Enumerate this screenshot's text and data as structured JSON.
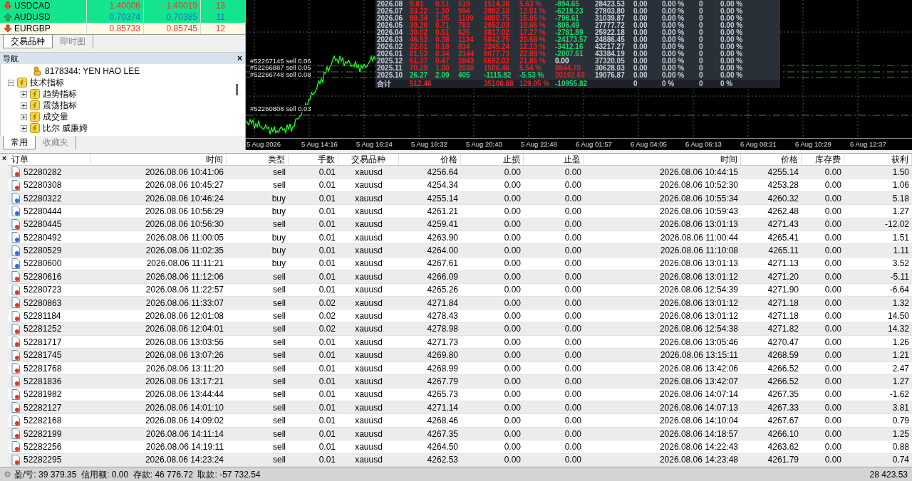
{
  "market_watch": {
    "rows": [
      {
        "symbol": "USDCAD",
        "bid": "1.40006",
        "ask": "1.40019",
        "spread": "13",
        "kind": "down",
        "highlighted": true
      },
      {
        "symbol": "AUDUSD",
        "bid": "0.70374",
        "ask": "0.70385",
        "spread": "11",
        "kind": "up",
        "highlighted": true
      },
      {
        "symbol": "EURGBP",
        "bid": "0.85733",
        "ask": "0.85745",
        "spread": "12",
        "kind": "down",
        "highlighted": false
      }
    ],
    "tabs": [
      {
        "label": "交易品种",
        "selected": true
      },
      {
        "label": "即时图",
        "selected": false
      }
    ]
  },
  "navigator": {
    "title": "导航",
    "close": "×",
    "tree": [
      {
        "label": "8178344: YEN HAO LEE",
        "kind": "account"
      },
      {
        "label": "技术指标",
        "kind": "folder",
        "expanded": true,
        "children": [
          {
            "label": "趋势指标",
            "kind": "folder",
            "expanded": false
          },
          {
            "label": "震荡指标",
            "kind": "folder",
            "expanded": false
          },
          {
            "label": "成交量",
            "kind": "folder",
            "expanded": false
          },
          {
            "label": "比尔 威廉姆",
            "kind": "folder",
            "expanded": false
          }
        ]
      }
    ],
    "tabs": [
      {
        "label": "常用",
        "selected": true
      },
      {
        "label": "收藏夹",
        "selected": false
      }
    ]
  },
  "chart": {
    "order_labels": [
      "#52267145 sell 0.06",
      "#52266887 sell 0.05",
      "#52266748 sell 0.08",
      "#52260808 sell 0.03"
    ],
    "stats": {
      "rows": [
        {
          "cells": [
            {
              "text": "2026.08",
              "color": "#c8d0dc"
            },
            {
              "text": "9.81",
              "color": "#e02424"
            },
            {
              "text": "0.51",
              "color": "#e02424"
            },
            {
              "text": "510",
              "color": "#e02424"
            },
            {
              "text": "1514.38",
              "color": "#e02424"
            },
            {
              "text": "5.63 %",
              "color": "#e02424"
            },
            {
              "text": "-894.65",
              "color": "#22d36a"
            },
            {
              "text": "28423.53",
              "color": "#c8d0dc"
            },
            {
              "text": "0.00",
              "color": "#c8d0dc"
            },
            {
              "text": "0.00 %",
              "color": "#c8d0dc"
            },
            {
              "text": "0",
              "color": "#c8d0dc"
            },
            {
              "text": "0.00 %",
              "color": "#c8d0dc"
            }
          ]
        },
        {
          "cells": [
            {
              "text": "2026.07",
              "color": "#c8d0dc"
            },
            {
              "text": "33.22",
              "color": "#e02424"
            },
            {
              "text": "1.30",
              "color": "#e02424"
            },
            {
              "text": "994",
              "color": "#e02424"
            },
            {
              "text": "2982.10",
              "color": "#e02424"
            },
            {
              "text": "12.01 %",
              "color": "#e02424"
            },
            {
              "text": "-6218.23",
              "color": "#22d36a"
            },
            {
              "text": "27803.80",
              "color": "#c8d0dc"
            },
            {
              "text": "0.00",
              "color": "#c8d0dc"
            },
            {
              "text": "0.00 %",
              "color": "#c8d0dc"
            },
            {
              "text": "0",
              "color": "#c8d0dc"
            },
            {
              "text": "0.00 %",
              "color": "#c8d0dc"
            }
          ]
        },
        {
          "cells": [
            {
              "text": "2026.06",
              "color": "#c8d0dc"
            },
            {
              "text": "80.34",
              "color": "#e02424"
            },
            {
              "text": "1.05",
              "color": "#e02424"
            },
            {
              "text": "1109",
              "color": "#e02424"
            },
            {
              "text": "4080.75",
              "color": "#e02424"
            },
            {
              "text": "15.05 %",
              "color": "#e02424"
            },
            {
              "text": "-798.61",
              "color": "#22d36a"
            },
            {
              "text": "31039.87",
              "color": "#c8d0dc"
            },
            {
              "text": "0.00",
              "color": "#c8d0dc"
            },
            {
              "text": "0.00 %",
              "color": "#c8d0dc"
            },
            {
              "text": "0",
              "color": "#c8d0dc"
            },
            {
              "text": "0.00 %",
              "color": "#c8d0dc"
            }
          ]
        },
        {
          "cells": [
            {
              "text": "2026.05",
              "color": "#c8d0dc"
            },
            {
              "text": "39.20",
              "color": "#e02424"
            },
            {
              "text": "0.71",
              "color": "#e02424"
            },
            {
              "text": "783",
              "color": "#e02424"
            },
            {
              "text": "2052.03",
              "color": "#e02424"
            },
            {
              "text": "10.66 %",
              "color": "#e02424"
            },
            {
              "text": "-806.49",
              "color": "#22d36a"
            },
            {
              "text": "27777.72",
              "color": "#c8d0dc"
            },
            {
              "text": "0.00",
              "color": "#c8d0dc"
            },
            {
              "text": "0.00 %",
              "color": "#c8d0dc"
            },
            {
              "text": "0",
              "color": "#c8d0dc"
            },
            {
              "text": "0.00 %",
              "color": "#c8d0dc"
            }
          ]
        },
        {
          "cells": [
            {
              "text": "2026.04",
              "color": "#c8d0dc"
            },
            {
              "text": "30.02",
              "color": "#e02424"
            },
            {
              "text": "0.51",
              "color": "#e02424"
            },
            {
              "text": "625",
              "color": "#e02424"
            },
            {
              "text": "3817.02",
              "color": "#e02424"
            },
            {
              "text": "17.27 %",
              "color": "#e02424"
            },
            {
              "text": "-2781.89",
              "color": "#22d36a"
            },
            {
              "text": "25922.18",
              "color": "#c8d0dc"
            },
            {
              "text": "0.00",
              "color": "#c8d0dc"
            },
            {
              "text": "0.00 %",
              "color": "#c8d0dc"
            },
            {
              "text": "0",
              "color": "#c8d0dc"
            },
            {
              "text": "0.00 %",
              "color": "#c8d0dc"
            }
          ]
        },
        {
          "cells": [
            {
              "text": "2026.03",
              "color": "#c8d0dc"
            },
            {
              "text": "46.53",
              "color": "#e02424"
            },
            {
              "text": "0.38",
              "color": "#e02424"
            },
            {
              "text": "1134",
              "color": "#e02424"
            },
            {
              "text": "5842.75",
              "color": "#e02424"
            },
            {
              "text": "20.68 %",
              "color": "#e02424"
            },
            {
              "text": "-24173.57",
              "color": "#22d36a"
            },
            {
              "text": "24886.45",
              "color": "#c8d0dc"
            },
            {
              "text": "0.00",
              "color": "#c8d0dc"
            },
            {
              "text": "0.00 %",
              "color": "#c8d0dc"
            },
            {
              "text": "0",
              "color": "#c8d0dc"
            },
            {
              "text": "0.00 %",
              "color": "#c8d0dc"
            }
          ]
        },
        {
          "cells": [
            {
              "text": "2026.02",
              "color": "#c8d0dc"
            },
            {
              "text": "22.01",
              "color": "#e02424"
            },
            {
              "text": "0.18",
              "color": "#e02424"
            },
            {
              "text": "834",
              "color": "#e02424"
            },
            {
              "text": "3245.24",
              "color": "#e02424"
            },
            {
              "text": "12.13 %",
              "color": "#e02424"
            },
            {
              "text": "-3412.16",
              "color": "#22d36a"
            },
            {
              "text": "43217.27",
              "color": "#c8d0dc"
            },
            {
              "text": "0.00",
              "color": "#c8d0dc"
            },
            {
              "text": "0.00 %",
              "color": "#c8d0dc"
            },
            {
              "text": "0",
              "color": "#c8d0dc"
            },
            {
              "text": "0.00 %",
              "color": "#c8d0dc"
            }
          ]
        },
        {
          "cells": [
            {
              "text": "2026.01",
              "color": "#c8d0dc"
            },
            {
              "text": "81.53",
              "color": "#e02424"
            },
            {
              "text": "0.34",
              "color": "#e02424"
            },
            {
              "text": "2144",
              "color": "#e02424"
            },
            {
              "text": "8077.73",
              "color": "#e02424"
            },
            {
              "text": "22.88 %",
              "color": "#e02424"
            },
            {
              "text": "-2007.61",
              "color": "#22d36a"
            },
            {
              "text": "43384.19",
              "color": "#c8d0dc"
            },
            {
              "text": "0.00",
              "color": "#c8d0dc"
            },
            {
              "text": "0.00 %",
              "color": "#c8d0dc"
            },
            {
              "text": "0",
              "color": "#c8d0dc"
            },
            {
              "text": "0.00 %",
              "color": "#c8d0dc"
            }
          ]
        },
        {
          "cells": [
            {
              "text": "2025.12",
              "color": "#c8d0dc"
            },
            {
              "text": "61.37",
              "color": "#e02424"
            },
            {
              "text": "0.47",
              "color": "#e02424"
            },
            {
              "text": "2843",
              "color": "#e02424"
            },
            {
              "text": "6692.02",
              "color": "#e02424"
            },
            {
              "text": "21.85 %",
              "color": "#e02424"
            },
            {
              "text": "0.00",
              "color": "#e8e8e8"
            },
            {
              "text": "37320.05",
              "color": "#c8d0dc"
            },
            {
              "text": "0.00",
              "color": "#c8d0dc"
            },
            {
              "text": "0.00 %",
              "color": "#c8d0dc"
            },
            {
              "text": "0",
              "color": "#c8d0dc"
            },
            {
              "text": "0.00 %",
              "color": "#c8d0dc"
            }
          ]
        },
        {
          "cells": [
            {
              "text": "2025.11",
              "color": "#c8d0dc"
            },
            {
              "text": "70.29",
              "color": "#e02424"
            },
            {
              "text": "1.00",
              "color": "#e02424"
            },
            {
              "text": "2030",
              "color": "#e02424"
            },
            {
              "text": "1506.46",
              "color": "#e02424"
            },
            {
              "text": "5.54 %",
              "color": "#e02424"
            },
            {
              "text": "8844.70",
              "color": "#e02424"
            },
            {
              "text": "30628.03",
              "color": "#c8d0dc"
            },
            {
              "text": "0.00",
              "color": "#c8d0dc"
            },
            {
              "text": "0.00 %",
              "color": "#c8d0dc"
            },
            {
              "text": "0",
              "color": "#c8d0dc"
            },
            {
              "text": "0.00 %",
              "color": "#c8d0dc"
            }
          ]
        },
        {
          "cells": [
            {
              "text": "2025.10",
              "color": "#c8d0dc"
            },
            {
              "text": "26.27",
              "color": "#22d36a"
            },
            {
              "text": "2.09",
              "color": "#22d36a"
            },
            {
              "text": "405",
              "color": "#22d36a"
            },
            {
              "text": "-1115.82",
              "color": "#22d36a"
            },
            {
              "text": "-5.53 %",
              "color": "#22d36a"
            },
            {
              "text": "20192.69",
              "color": "#e02424"
            },
            {
              "text": "19076.87",
              "color": "#c8d0dc"
            },
            {
              "text": "0.00",
              "color": "#c8d0dc"
            },
            {
              "text": "0.00 %",
              "color": "#c8d0dc"
            },
            {
              "text": "0",
              "color": "#c8d0dc"
            },
            {
              "text": "0.00 %",
              "color": "#c8d0dc"
            }
          ]
        }
      ],
      "total": {
        "label": {
          "text": "合计",
          "color": "#c8d0dc"
        },
        "column_2": {
          "text": "512.46",
          "color": "#e02424"
        },
        "column_5": {
          "text": "35108.88",
          "color": "#e02424"
        },
        "column_6": {
          "text": "129.05 %",
          "color": "#e02424"
        },
        "column_7": {
          "text": "-10955.82",
          "color": "#22d36a"
        },
        "column_9": {
          "text": "0",
          "color": "#c8d0dc"
        },
        "column_10": {
          "text": "0 %",
          "color": "#c8d0dc"
        },
        "column_11": {
          "text": "0",
          "color": "#c8d0dc"
        },
        "column_12": {
          "text": "0 %",
          "color": "#c8d0dc"
        }
      }
    },
    "x_labels": [
      "5 Aug 2026",
      "5 Aug 14:16",
      "5 Aug 16:24",
      "5 Aug 18:32",
      "5 Aug 20:40",
      "5 Aug 22:48",
      "6 Aug 01:57",
      "6 Aug 04:05",
      "6 Aug 06:13",
      "6 Aug 08:21",
      "6 Aug 10:29",
      "6 Aug 12:37"
    ]
  },
  "terminal": {
    "close": "×",
    "columns": [
      "订单",
      "时间",
      "类型",
      "手数",
      "交易品种",
      "价格",
      "止损",
      "止盈",
      "时间",
      "价格",
      "库存费",
      "获利"
    ],
    "rows": [
      {
        "kind": "sell",
        "cells": [
          "52280282",
          "2026.08.06 10:41:06",
          "sell",
          "0.01",
          "xauusd",
          "4256.64",
          "0.00",
          "0.00",
          "2026.08.06 10:44:15",
          "4255.14",
          "0.00",
          "1.50"
        ]
      },
      {
        "kind": "sell",
        "cells": [
          "52280308",
          "2026.08.06 10:45:27",
          "sell",
          "0.01",
          "xauusd",
          "4254.34",
          "0.00",
          "0.00",
          "2026.08.06 10:52:30",
          "4253.28",
          "0.00",
          "1.06"
        ]
      },
      {
        "kind": "buy",
        "cells": [
          "52280322",
          "2026.08.06 10:46:24",
          "buy",
          "0.01",
          "xauusd",
          "4255.14",
          "0.00",
          "0.00",
          "2026.08.06 10:55:34",
          "4260.32",
          "0.00",
          "5.18"
        ]
      },
      {
        "kind": "buy",
        "cells": [
          "52280444",
          "2026.08.06 10:56:29",
          "buy",
          "0.01",
          "xauusd",
          "4261.21",
          "0.00",
          "0.00",
          "2026.08.06 10:59:43",
          "4262.48",
          "0.00",
          "1.27"
        ]
      },
      {
        "kind": "sell",
        "cells": [
          "52280445",
          "2026.08.06 10:56:30",
          "sell",
          "0.01",
          "xauusd",
          "4259.41",
          "0.00",
          "0.00",
          "2026.08.06 13:01:13",
          "4271.43",
          "0.00",
          "-12.02"
        ]
      },
      {
        "kind": "buy",
        "cells": [
          "52280492",
          "2026.08.06 11:00:05",
          "buy",
          "0.01",
          "xauusd",
          "4263.90",
          "0.00",
          "0.00",
          "2026.08.06 11:00:44",
          "4265.41",
          "0.00",
          "1.51"
        ]
      },
      {
        "kind": "buy",
        "cells": [
          "52280529",
          "2026.08.06 11:02:35",
          "buy",
          "0.01",
          "xauusd",
          "4264.00",
          "0.00",
          "0.00",
          "2026.08.06 11:10:08",
          "4265.11",
          "0.00",
          "1.11"
        ]
      },
      {
        "kind": "buy",
        "cells": [
          "52280600",
          "2026.08.06 11:11:21",
          "buy",
          "0.01",
          "xauusd",
          "4267.61",
          "0.00",
          "0.00",
          "2026.08.06 13:01:13",
          "4271.13",
          "0.00",
          "3.52"
        ]
      },
      {
        "kind": "sell",
        "cells": [
          "52280616",
          "2026.08.06 11:12:06",
          "sell",
          "0.01",
          "xauusd",
          "4266.09",
          "0.00",
          "0.00",
          "2026.08.06 13:01:12",
          "4271.20",
          "0.00",
          "-5.11"
        ]
      },
      {
        "kind": "sell",
        "cells": [
          "52280723",
          "2026.08.06 11:22:57",
          "sell",
          "0.01",
          "xauusd",
          "4265.26",
          "0.00",
          "0.00",
          "2026.08.06 12:54:39",
          "4271.90",
          "0.00",
          "-6.64"
        ]
      },
      {
        "kind": "sell",
        "cells": [
          "52280863",
          "2026.08.06 11:33:07",
          "sell",
          "0.02",
          "xauusd",
          "4271.84",
          "0.00",
          "0.00",
          "2026.08.06 13:01:12",
          "4271.18",
          "0.00",
          "1.32"
        ]
      },
      {
        "kind": "sell",
        "cells": [
          "52281184",
          "2026.08.06 12:01:08",
          "sell",
          "0.02",
          "xauusd",
          "4278.43",
          "0.00",
          "0.00",
          "2026.08.06 13:01:12",
          "4271.18",
          "0.00",
          "14.50"
        ]
      },
      {
        "kind": "sell",
        "cells": [
          "52281252",
          "2026.08.06 12:04:01",
          "sell",
          "0.02",
          "xauusd",
          "4278.98",
          "0.00",
          "0.00",
          "2026.08.06 12:54:38",
          "4271.82",
          "0.00",
          "14.32"
        ]
      },
      {
        "kind": "sell",
        "cells": [
          "52281717",
          "2026.08.06 13:03:56",
          "sell",
          "0.01",
          "xauusd",
          "4271.73",
          "0.00",
          "0.00",
          "2026.08.06 13:05:46",
          "4270.47",
          "0.00",
          "1.26"
        ]
      },
      {
        "kind": "sell",
        "cells": [
          "52281745",
          "2026.08.06 13:07:26",
          "sell",
          "0.01",
          "xauusd",
          "4269.80",
          "0.00",
          "0.00",
          "2026.08.06 13:15:11",
          "4268.59",
          "0.00",
          "1.21"
        ]
      },
      {
        "kind": "sell",
        "cells": [
          "52281768",
          "2026.08.06 13:11:20",
          "sell",
          "0.01",
          "xauusd",
          "4268.99",
          "0.00",
          "0.00",
          "2026.08.06 13:42:06",
          "4266.52",
          "0.00",
          "2.47"
        ]
      },
      {
        "kind": "sell",
        "cells": [
          "52281836",
          "2026.08.06 13:17:21",
          "sell",
          "0.01",
          "xauusd",
          "4267.79",
          "0.00",
          "0.00",
          "2026.08.06 13:42:07",
          "4266.52",
          "0.00",
          "1.27"
        ]
      },
      {
        "kind": "sell",
        "cells": [
          "52281982",
          "2026.08.06 13:44:44",
          "sell",
          "0.01",
          "xauusd",
          "4265.73",
          "0.00",
          "0.00",
          "2026.08.06 14:07:14",
          "4267.35",
          "0.00",
          "-1.62"
        ]
      },
      {
        "kind": "sell",
        "cells": [
          "52282127",
          "2026.08.06 14:01:10",
          "sell",
          "0.01",
          "xauusd",
          "4271.14",
          "0.00",
          "0.00",
          "2026.08.06 14:07:13",
          "4267.33",
          "0.00",
          "3.81"
        ]
      },
      {
        "kind": "sell",
        "cells": [
          "52282168",
          "2026.08.06 14:09:02",
          "sell",
          "0.01",
          "xauusd",
          "4268.46",
          "0.00",
          "0.00",
          "2026.08.06 14:10:04",
          "4267.67",
          "0.00",
          "0.79"
        ]
      },
      {
        "kind": "sell",
        "cells": [
          "52282199",
          "2026.08.06 14:11:14",
          "sell",
          "0.01",
          "xauusd",
          "4267.35",
          "0.00",
          "0.00",
          "2026.08.06 14:18:57",
          "4266.10",
          "0.00",
          "1.25"
        ]
      },
      {
        "kind": "sell",
        "cells": [
          "52282256",
          "2026.08.06 14:19:11",
          "sell",
          "0.01",
          "xauusd",
          "4264.50",
          "0.00",
          "0.00",
          "2026.08.06 14:22:43",
          "4263.62",
          "0.00",
          "0.88"
        ]
      },
      {
        "kind": "sell",
        "cells": [
          "52282295",
          "2026.08.06 14:23:24",
          "sell",
          "0.01",
          "xauusd",
          "4262.53",
          "0.00",
          "0.00",
          "2026.08.06 14:23:48",
          "4261.79",
          "0.00",
          "0.74"
        ]
      }
    ],
    "status": {
      "summary": "盈/亏: 39 379.35  信用额: 0.00  存款: 46 776.72  取款: -57 732.54",
      "total": "28 423.53"
    }
  }
}
